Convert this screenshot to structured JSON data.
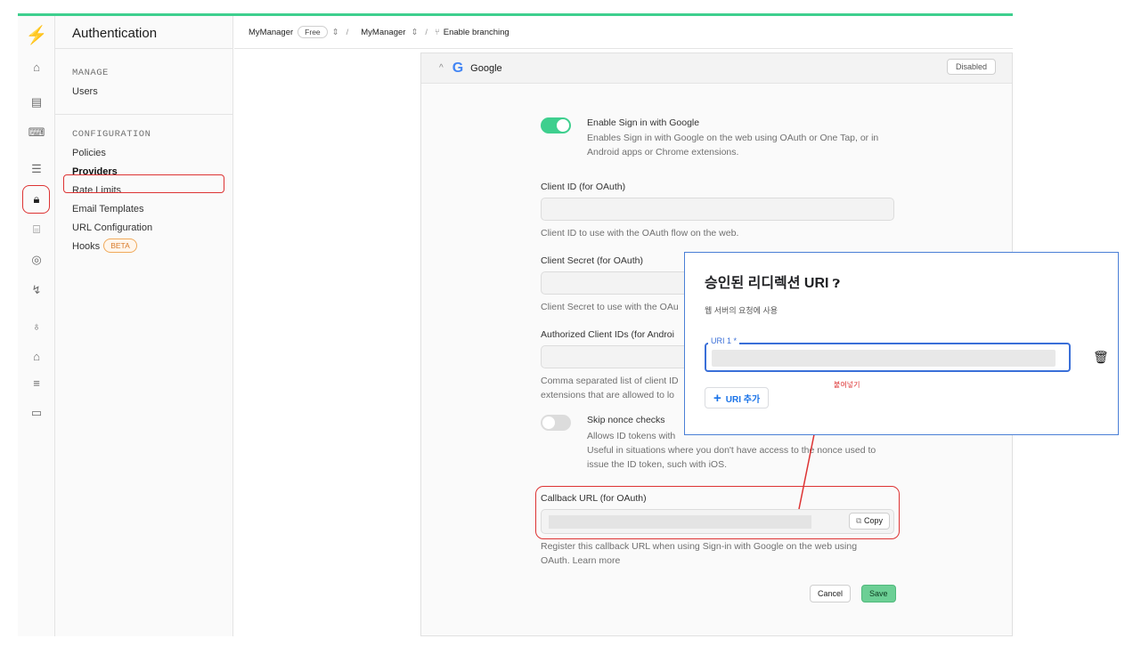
{
  "app": {
    "section_title": "Authentication"
  },
  "sidebar": {
    "manage_label": "MANAGE",
    "manage_items": [
      "Users"
    ],
    "config_label": "CONFIGURATION",
    "config_items": [
      "Policies",
      "Providers",
      "Rate Limits",
      "Email Templates",
      "URL Configuration"
    ],
    "hooks_label": "Hooks",
    "hooks_badge": "BETA"
  },
  "breadcrumb": {
    "org": "MyManager",
    "plan": "Free",
    "project": "MyManager",
    "sep": "/",
    "branch": "Enable branching"
  },
  "provider": {
    "logo": "G",
    "name": "Google",
    "status_button": "Disabled",
    "enable": {
      "label": "Enable Sign in with Google",
      "description": "Enables Sign in with Google on the web using OAuth or One Tap, or in Android apps or Chrome extensions.",
      "on": true
    },
    "client_id": {
      "label": "Client ID (for OAuth)",
      "help": "Client ID to use with the OAuth flow on the web."
    },
    "client_secret": {
      "label": "Client Secret (for OAuth)",
      "help": "Client Secret to use with the OAu"
    },
    "authorized_ids": {
      "label": "Authorized Client IDs (for Androi",
      "help_line1": "Comma separated list of client ID",
      "help_line2": "extensions that are allowed to lo"
    },
    "skip_nonce": {
      "label": "Skip nonce checks",
      "line1": "Allows ID tokens with",
      "line2": "Useful in situations where you don't have access to the nonce used to",
      "line3": "issue the ID token, such with iOS.",
      "on": false
    },
    "callback": {
      "label": "Callback URL (for OAuth)",
      "copy_button": "Copy",
      "help_line1": "Register this callback URL when using Sign-in with Google on the web using",
      "help_line2": "OAuth. Learn more"
    },
    "cancel_button": "Cancel",
    "save_button": "Save"
  },
  "overlay": {
    "title": "승인된 리디렉션 URI",
    "subtitle": "웹 서버의 요청에 사용",
    "field_label": "URI 1 *",
    "add_button": "URI 추가",
    "annotation": "붙여넣기"
  },
  "colors": {
    "brand": "#3ecf8e",
    "annotation": "#dd3333",
    "google_blue": "#1a73e8"
  }
}
